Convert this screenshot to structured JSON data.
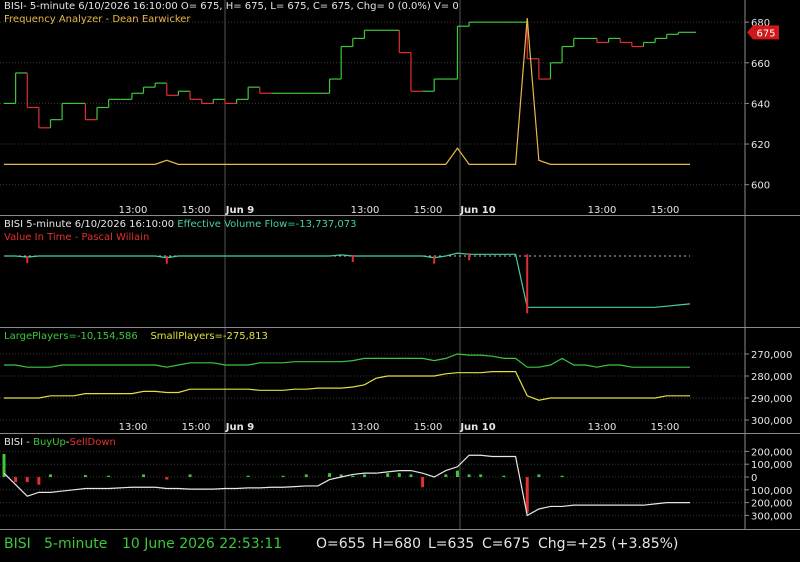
{
  "app": {
    "header_line1": "BISI- 5-minute 6/10/2026 16:10:00 O= 675, H= 675, L= 675, C= 675, Chg= 0 (0.0%) V= 0",
    "header_line2": "Frequency Analyzer - Dean Earwicker",
    "last_price_badge": "675"
  },
  "time_axis": {
    "labels": [
      "13:00",
      "15:00",
      "Jun 9",
      "13:00",
      "15:00",
      "Jun 10",
      "13:00",
      "15:00"
    ],
    "bold": [
      false,
      false,
      true,
      false,
      false,
      true,
      false,
      false
    ]
  },
  "panes": {
    "pane2": {
      "title": "BISI 5-minute  6/10/2026 16:10:00",
      "indicator": "Effective Volume Flow=-13,737,073",
      "subtitle": "Value In Time - Pascal Willain"
    },
    "pane3": {
      "large": "LargePlayers=-10,154,586",
      "small": "SmallPlayers=-275,813"
    },
    "pane4": {
      "prefix": "BISI - ",
      "buy": "BuyUp",
      "sep": "-",
      "sell": "SellDown"
    }
  },
  "status_bar": {
    "symbol": "BISI",
    "interval": "5-minute",
    "datetime": "10 June 2026 22:53:11",
    "open": "O=655",
    "high": "H=680",
    "low": "L=635",
    "close": "C=675",
    "change": "Chg=+25 (+3.85%)"
  },
  "colors": {
    "up": "#3cc73c",
    "down": "#e03030",
    "orange": "#e8b84a",
    "yellow": "#e0e040",
    "green": "#3cc73c",
    "cyan": "#46d0a0",
    "white": "#e6e6e6",
    "grid": "#3a3a3a"
  },
  "chart_data": [
    {
      "type": "line",
      "title": "Frequency Analyzer - Dean Earwicker",
      "ylim": [
        590,
        685
      ],
      "y_ticks": [
        "600",
        "620",
        "640",
        "660",
        "680"
      ],
      "series": [
        {
          "values": [
            640,
            655,
            638,
            628,
            632,
            640,
            640,
            632,
            638,
            642,
            642,
            645,
            648,
            650,
            644,
            646,
            642,
            640,
            642,
            640,
            642,
            648,
            645,
            645,
            645,
            645,
            645,
            645,
            652,
            668,
            672,
            676,
            676,
            676,
            665,
            646,
            646,
            652,
            652,
            678,
            680,
            680,
            680,
            680,
            680,
            662,
            652,
            660,
            668,
            672,
            672,
            670,
            672,
            670,
            668,
            670,
            672,
            674,
            675,
            675
          ]
        },
        {
          "values": [
            610,
            610,
            610,
            610,
            610,
            610,
            610,
            610,
            610,
            610,
            610,
            610,
            610,
            610,
            612,
            610,
            610,
            610,
            610,
            610,
            610,
            610,
            610,
            610,
            610,
            610,
            610,
            610,
            610,
            610,
            610,
            610,
            610,
            610,
            610,
            610,
            610,
            610,
            610,
            618,
            610,
            610,
            610,
            610,
            610,
            682,
            612,
            610,
            610,
            610,
            610,
            610,
            610,
            610,
            610,
            610,
            610,
            610,
            610,
            610
          ]
        }
      ]
    },
    {
      "type": "line",
      "title": "Value In Time - Pascal Willain",
      "series": [
        {
          "name": "Effective Volume Flow",
          "values": [
            0,
            0,
            -0.2,
            0,
            0,
            0,
            0,
            0,
            0,
            0,
            0,
            0,
            0,
            0,
            -0.3,
            0,
            0,
            0,
            0,
            0,
            0,
            0,
            0,
            0,
            0,
            0,
            0,
            0,
            0,
            0.2,
            0,
            0,
            0,
            0,
            0,
            0,
            0,
            -0.3,
            0,
            0.5,
            0.3,
            0.3,
            0.3,
            0.3,
            0.3,
            -9,
            -9,
            -9,
            -9,
            -9,
            -9,
            -9,
            -9,
            -9,
            -9,
            -9,
            -9,
            -8.8,
            -8.6,
            -8.4
          ]
        }
      ]
    },
    {
      "type": "line",
      "ylim": [
        305000,
        262000
      ],
      "y_ticks": [
        "270,000",
        "280,000",
        "290,000",
        "300,000"
      ],
      "series": [
        {
          "name": "LargePlayers",
          "values": [
            275000,
            275000,
            276000,
            276000,
            276000,
            275000,
            275000,
            275000,
            275000,
            275000,
            275000,
            275000,
            275000,
            275000,
            276000,
            275000,
            274000,
            274000,
            274000,
            275000,
            275000,
            275000,
            274000,
            274000,
            274000,
            273500,
            273500,
            273500,
            273500,
            273500,
            273000,
            272000,
            272000,
            272000,
            272000,
            272000,
            272000,
            273000,
            272000,
            270000,
            270500,
            270500,
            271000,
            272000,
            272000,
            276000,
            276000,
            275000,
            272000,
            275000,
            275000,
            276000,
            275000,
            275000,
            276000,
            276000,
            276000,
            276000,
            276000,
            276000
          ]
        },
        {
          "name": "SmallPlayers",
          "values": [
            290000,
            290000,
            290000,
            290000,
            289000,
            289000,
            289000,
            288000,
            288000,
            288000,
            288000,
            288000,
            287000,
            287000,
            287500,
            287500,
            286000,
            286000,
            286000,
            286000,
            286000,
            286000,
            286500,
            286500,
            286500,
            286000,
            286000,
            285500,
            285500,
            285500,
            285000,
            284000,
            281000,
            280000,
            280000,
            280000,
            280000,
            280000,
            279000,
            278500,
            278500,
            278500,
            278000,
            278000,
            278000,
            289000,
            291000,
            290000,
            290000,
            290000,
            290000,
            290000,
            290000,
            290000,
            290000,
            290000,
            290000,
            289000,
            289000,
            289000
          ]
        }
      ]
    },
    {
      "type": "bar",
      "title": "BISI - BuyUp-SellDown",
      "ylim": [
        -320000,
        260000
      ],
      "y_ticks": [
        "200,000",
        "100,000",
        "0",
        "100,000",
        "200,000",
        "300,000"
      ],
      "series": [
        {
          "name": "line",
          "values": [
            30000,
            -60000,
            -150000,
            -120000,
            -120000,
            -110000,
            -100000,
            -90000,
            -90000,
            -90000,
            -85000,
            -80000,
            -80000,
            -80000,
            -90000,
            -90000,
            -95000,
            -95000,
            -95000,
            -90000,
            -90000,
            -85000,
            -85000,
            -80000,
            -80000,
            -75000,
            -70000,
            -70000,
            -20000,
            0,
            20000,
            30000,
            30000,
            40000,
            50000,
            50000,
            30000,
            0,
            50000,
            80000,
            170000,
            170000,
            160000,
            160000,
            160000,
            -300000,
            -250000,
            -230000,
            -230000,
            -220000,
            -220000,
            -220000,
            -220000,
            -220000,
            -220000,
            -220000,
            -210000,
            -200000,
            -200000,
            -200000
          ]
        },
        {
          "name": "bars",
          "values": [
            180000,
            -40000,
            -40000,
            -60000,
            20000,
            0,
            0,
            15000,
            0,
            10000,
            0,
            0,
            20000,
            0,
            -20000,
            0,
            20000,
            0,
            0,
            0,
            0,
            10000,
            0,
            0,
            10000,
            0,
            20000,
            0,
            30000,
            20000,
            10000,
            20000,
            0,
            30000,
            30000,
            20000,
            -80000,
            0,
            20000,
            50000,
            20000,
            20000,
            0,
            10000,
            0,
            -280000,
            20000,
            0,
            10000,
            0,
            0,
            0,
            0,
            0,
            0,
            0,
            0,
            0,
            0,
            0
          ]
        }
      ]
    }
  ]
}
